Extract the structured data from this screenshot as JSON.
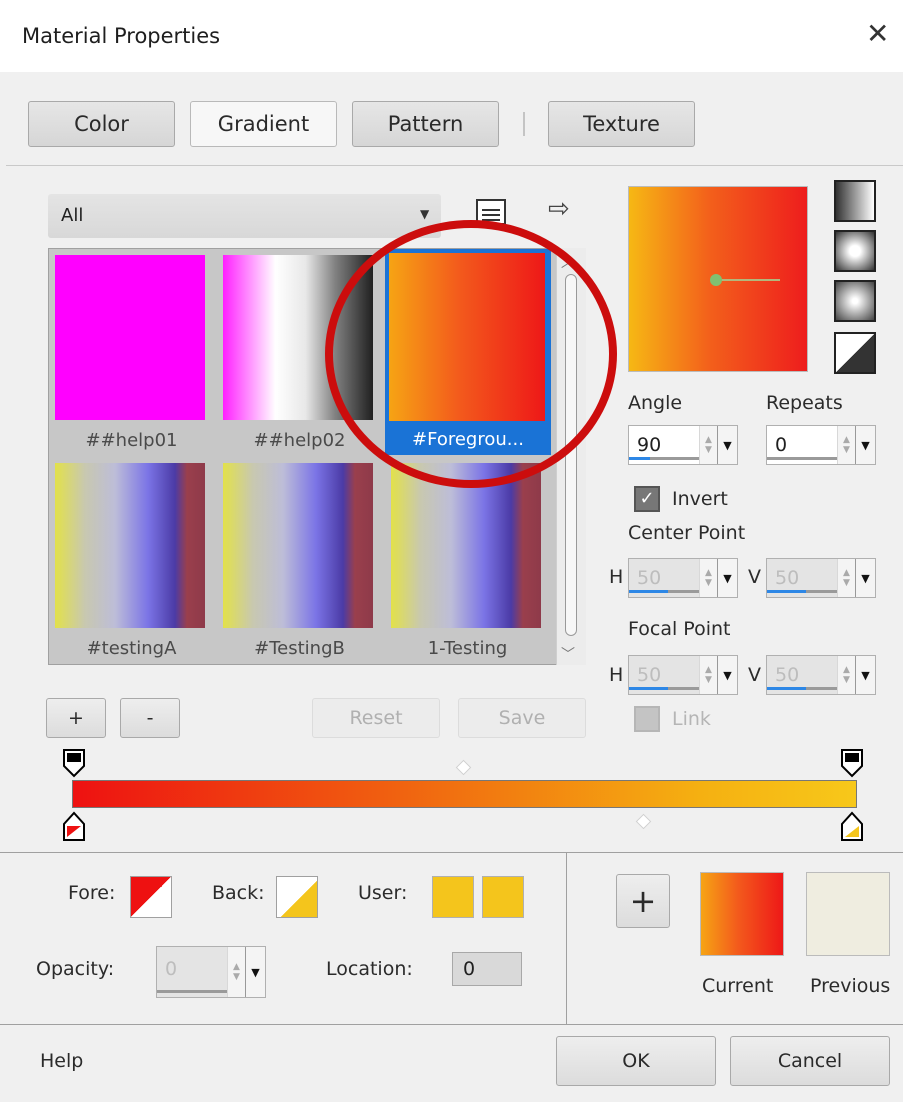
{
  "window": {
    "title": "Material Properties",
    "close": "✕"
  },
  "tabs": [
    {
      "label": "Color",
      "active": false
    },
    {
      "label": "Gradient",
      "active": true
    },
    {
      "label": "Pattern",
      "active": false
    },
    {
      "label": "Texture",
      "active": false
    }
  ],
  "gallery": {
    "category": "All",
    "items": [
      {
        "label": "##help01",
        "selected": false
      },
      {
        "label": "##help02",
        "selected": false
      },
      {
        "label": "#Foregrou...",
        "selected": true
      },
      {
        "label": "#testingA",
        "selected": false
      },
      {
        "label": "#TestingB",
        "selected": false
      },
      {
        "label": "1-Testing",
        "selected": false
      }
    ]
  },
  "buttons": {
    "add": "+",
    "remove": "-",
    "reset": "Reset",
    "save": "Save"
  },
  "settings": {
    "angle_label": "Angle",
    "angle": "90",
    "repeats_label": "Repeats",
    "repeats": "0",
    "invert_label": "Invert",
    "invert_checked": true,
    "center_label": "Center Point",
    "center_h": "50",
    "center_v": "50",
    "focal_label": "Focal Point",
    "focal_h": "50",
    "focal_v": "50",
    "h": "H",
    "v": "V",
    "link_label": "Link",
    "link_checked": false
  },
  "bottom": {
    "fore_label": "Fore:",
    "back_label": "Back:",
    "user_label": "User:",
    "opacity_label": "Opacity:",
    "opacity": "0",
    "location_label": "Location:",
    "location": "0",
    "add": "+",
    "current_label": "Current",
    "previous_label": "Previous"
  },
  "footer": {
    "help": "Help",
    "ok": "OK",
    "cancel": "Cancel"
  },
  "colors": {
    "red": "#ee1111",
    "gold": "#f4c51c",
    "select_blue": "#1a73d6",
    "circle": "#cc0d0d"
  }
}
